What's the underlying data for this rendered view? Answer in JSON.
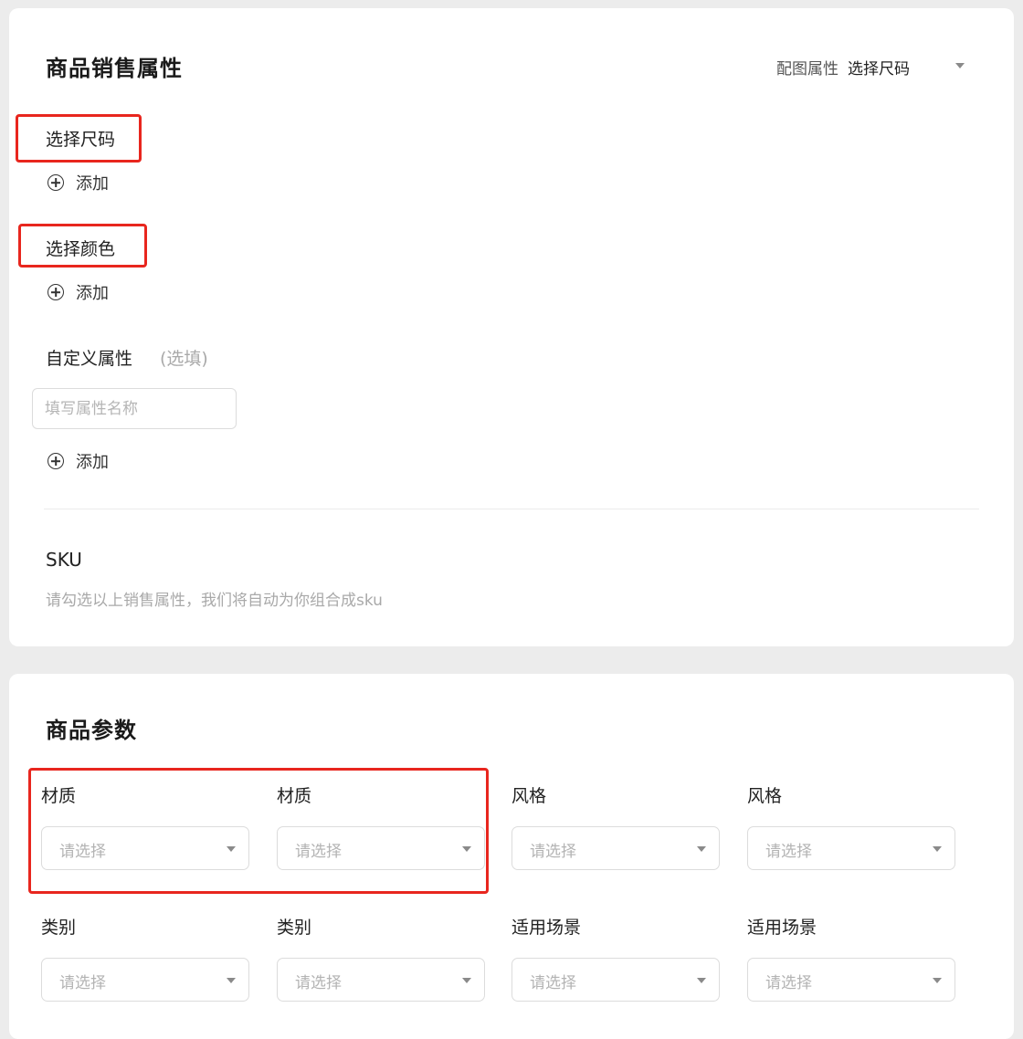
{
  "sales": {
    "title": "商品销售属性",
    "image_attr_label": "配图属性",
    "image_attr_value": "选择尺码",
    "size_label": "选择尺码",
    "color_label": "选择颜色",
    "add_label": "添加",
    "custom_label": "自定义属性",
    "custom_optional": "(选填)",
    "custom_placeholder": "填写属性名称",
    "sku_title": "SKU",
    "sku_hint": "请勾选以上销售属性，我们将自动为你组合成sku"
  },
  "params": {
    "title": "商品参数",
    "placeholder": "请选择",
    "fields": [
      {
        "label": "材质"
      },
      {
        "label": "材质"
      },
      {
        "label": "风格"
      },
      {
        "label": "风格"
      },
      {
        "label": "类别"
      },
      {
        "label": "类别"
      },
      {
        "label": "适用场景"
      },
      {
        "label": "适用场景"
      }
    ]
  },
  "colors": {
    "highlight": "#e8261e",
    "page_bg": "#ececec",
    "card_bg": "#ffffff"
  }
}
